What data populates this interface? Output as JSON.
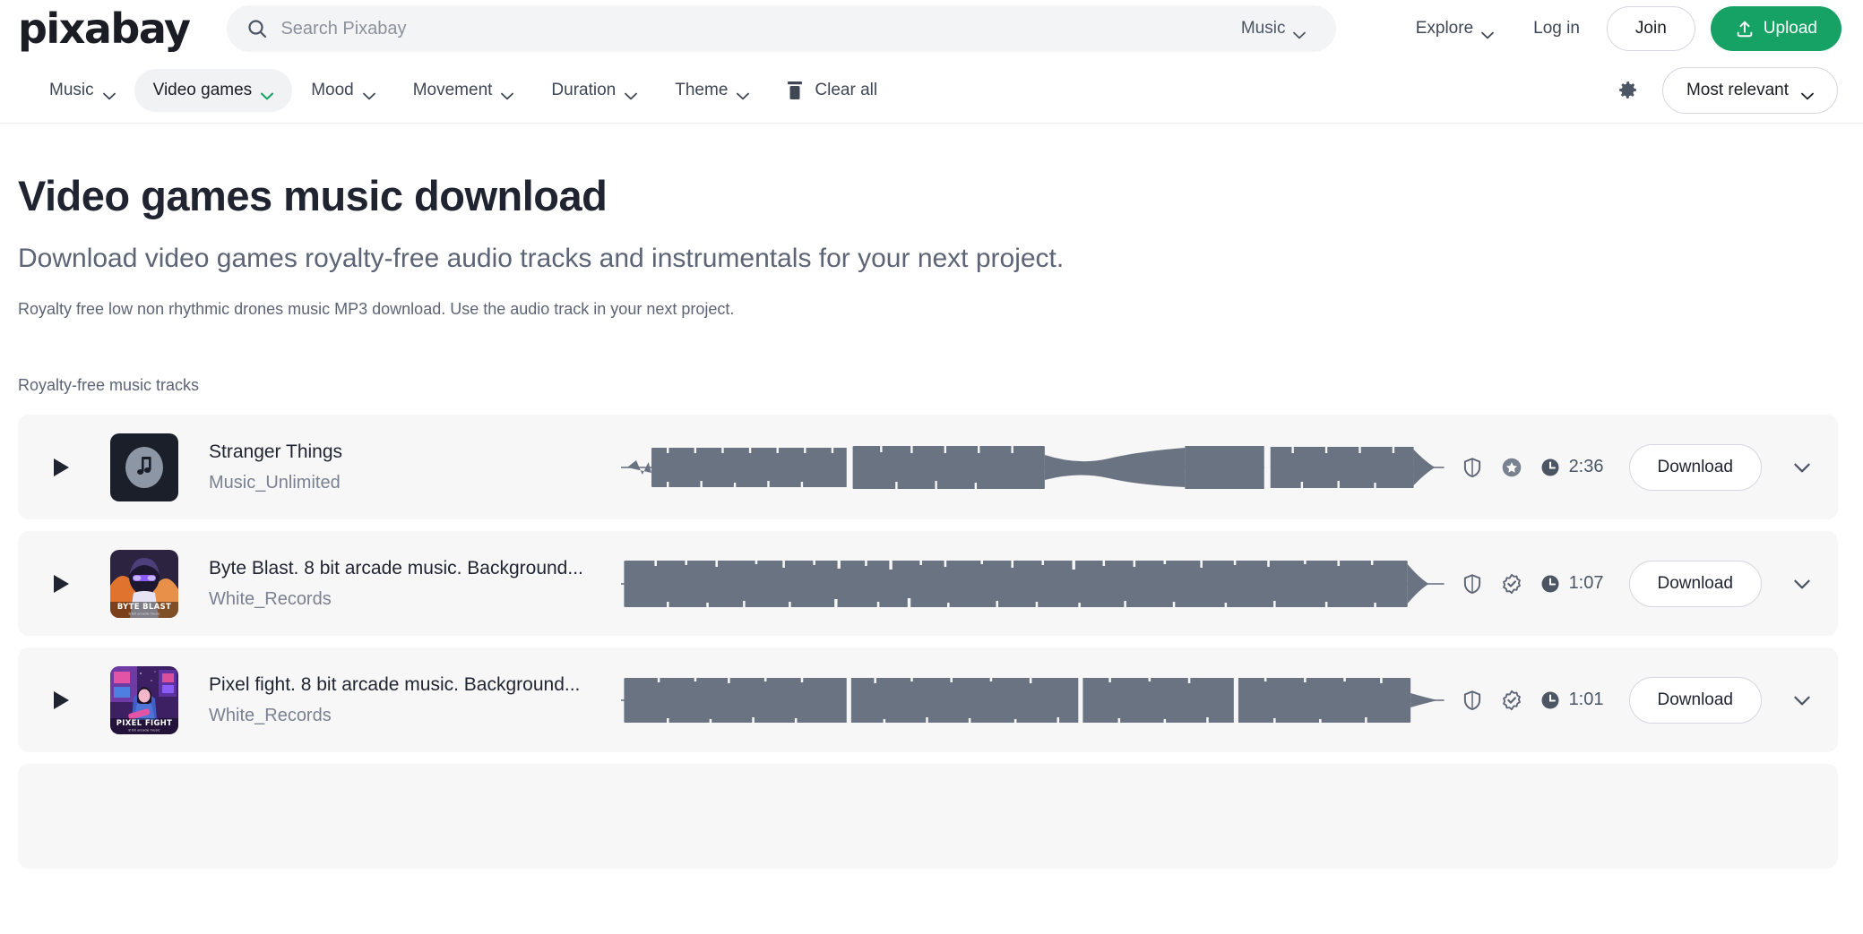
{
  "header": {
    "logo": "pixabay",
    "search": {
      "placeholder": "Search Pixabay",
      "value": ""
    },
    "category_select": {
      "label": "Music",
      "icon": "chevron-down-icon"
    },
    "search_icon": "search-icon",
    "explore": "Explore",
    "login": "Log in",
    "join": "Join",
    "upload": "Upload",
    "upload_icon": "upload-icon",
    "upload_color": "#17a265"
  },
  "filterbar": {
    "filters": [
      {
        "label": "Music",
        "active": false
      },
      {
        "label": "Video games",
        "active": true
      },
      {
        "label": "Mood",
        "active": false
      },
      {
        "label": "Movement",
        "active": false
      },
      {
        "label": "Duration",
        "active": false
      },
      {
        "label": "Theme",
        "active": false
      }
    ],
    "clear_all": "Clear all",
    "clear_all_icon": "trash-icon",
    "settings_icon": "gear-icon",
    "sort": {
      "label": "Most relevant",
      "icon": "chevron-down-icon"
    },
    "active_accent": "#17a265"
  },
  "main": {
    "title": "Video games music download",
    "subtitle": "Download video games royalty-free audio tracks and instrumentals for your next project.",
    "description": "Royalty free low non rhythmic drones music MP3 download. Use the audio track in your next project.",
    "section_label": "Royalty-free music tracks"
  },
  "tracks": [
    {
      "title": "Stranger Things",
      "artist": "Music_Unlimited",
      "duration": "2:36",
      "download_label": "Download",
      "play_icon": "play-icon",
      "shield_icon": "shield-icon",
      "badge_icon": "star-badge-icon",
      "clock_icon": "clock-icon",
      "expand_icon": "chevron-down-icon",
      "thumbnail": {
        "type": "music-note",
        "bg": "#1b1f2a",
        "fg": "#8d96a5"
      },
      "waveform_color": "#6a7382"
    },
    {
      "title": "Byte Blast. 8 bit arcade music. Background...",
      "artist": "White_Records",
      "duration": "1:07",
      "download_label": "Download",
      "play_icon": "play-icon",
      "shield_icon": "shield-icon",
      "badge_icon": "verified-badge-icon",
      "clock_icon": "clock-icon",
      "expand_icon": "chevron-down-icon",
      "thumbnail": {
        "type": "artwork-byte-blast",
        "caption": "BYTE BLAST",
        "bg": "#2b2340",
        "fg": "#f08a42"
      },
      "waveform_color": "#6a7382"
    },
    {
      "title": "Pixel fight. 8 bit arcade music. Background...",
      "artist": "White_Records",
      "duration": "1:01",
      "download_label": "Download",
      "play_icon": "play-icon",
      "shield_icon": "shield-icon",
      "badge_icon": "verified-badge-icon",
      "clock_icon": "clock-icon",
      "expand_icon": "chevron-down-icon",
      "thumbnail": {
        "type": "artwork-pixel-fight",
        "caption": "PIXEL FIGHT",
        "bg": "#7b3fa8",
        "fg": "#ec5fa8"
      },
      "waveform_color": "#6a7382"
    }
  ]
}
